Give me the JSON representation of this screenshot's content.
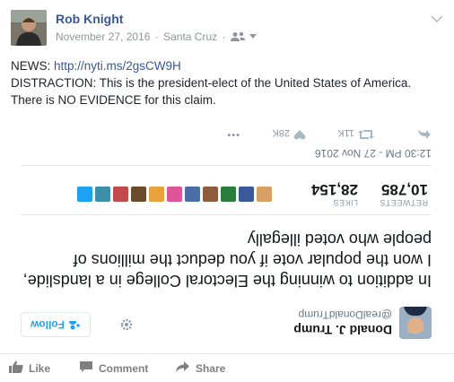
{
  "author": {
    "name": "Rob Knight",
    "date": "November 27, 2016",
    "location": "Santa Cruz",
    "separator": "·"
  },
  "post": {
    "line1_prefix": "NEWS: ",
    "link": "http://nyti.ms/2gsCW9H",
    "line2": "DISTRACTION: This is the president-elect of the United States of America.",
    "line3": "There is NO EVIDENCE for this claim."
  },
  "tweet": {
    "display": "rotated-180",
    "name": "Donald J. Trump",
    "handle": "@realDonaldTrump",
    "follow_label": "Follow",
    "text": "In addition to winning the Electoral College in a landslide, I won the popular vote if you deduct the millions of people who voted illegally",
    "retweets_label": "RETWEETS",
    "retweets": "10,785",
    "likes_label": "LIKES",
    "likes": "28,154",
    "date": "12:30 PM - 27 Nov 2016",
    "retweet_count": "11K",
    "like_count": "28K",
    "more": "•••",
    "face_colors": [
      "#d9a066",
      "#3b5998",
      "#2a7d3b",
      "#8e5b3c",
      "#4a6fa5",
      "#e0559a",
      "#e8a23b",
      "#6b4a2c",
      "#c24a4a",
      "#3d8ea8",
      "#1da1f2"
    ]
  },
  "actions": {
    "like": "Like",
    "comment": "Comment",
    "share": "Share"
  },
  "colors": {
    "fb_link": "#365899",
    "twitter_blue": "#1da1f2"
  }
}
